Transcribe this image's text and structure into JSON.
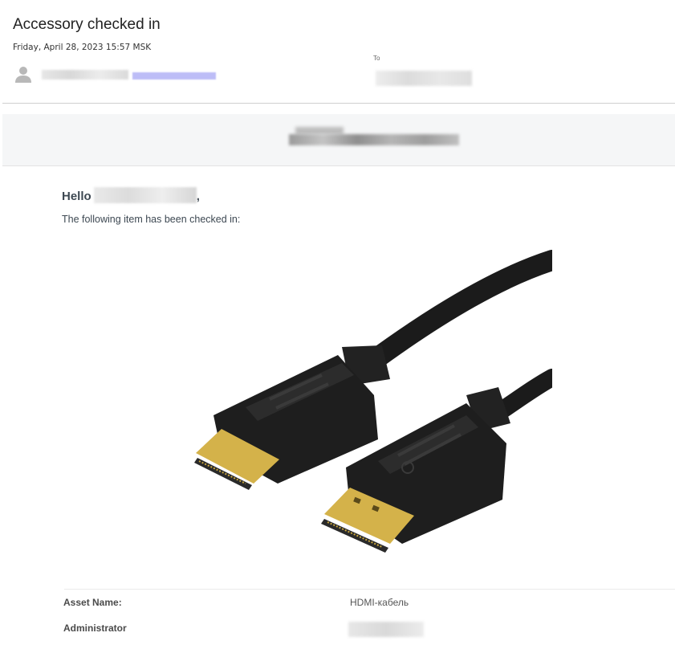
{
  "email": {
    "subject": "Accessory checked in",
    "date": "Friday, April 28, 2023 15:57 MSK",
    "to_label": "To"
  },
  "body": {
    "greeting": "Hello",
    "greeting_punct": ",",
    "intro": "The following item has been checked in:"
  },
  "details": {
    "rows": [
      {
        "label": "Asset Name:",
        "value": "HDMI-кабель"
      },
      {
        "label": "Administrator",
        "value": ""
      }
    ]
  },
  "icons": {
    "avatar": "person-icon"
  },
  "colors": {
    "cable": "#1b1b1b",
    "connector_gold": "#d4b24a",
    "banner_bg": "#f5f6f7"
  }
}
